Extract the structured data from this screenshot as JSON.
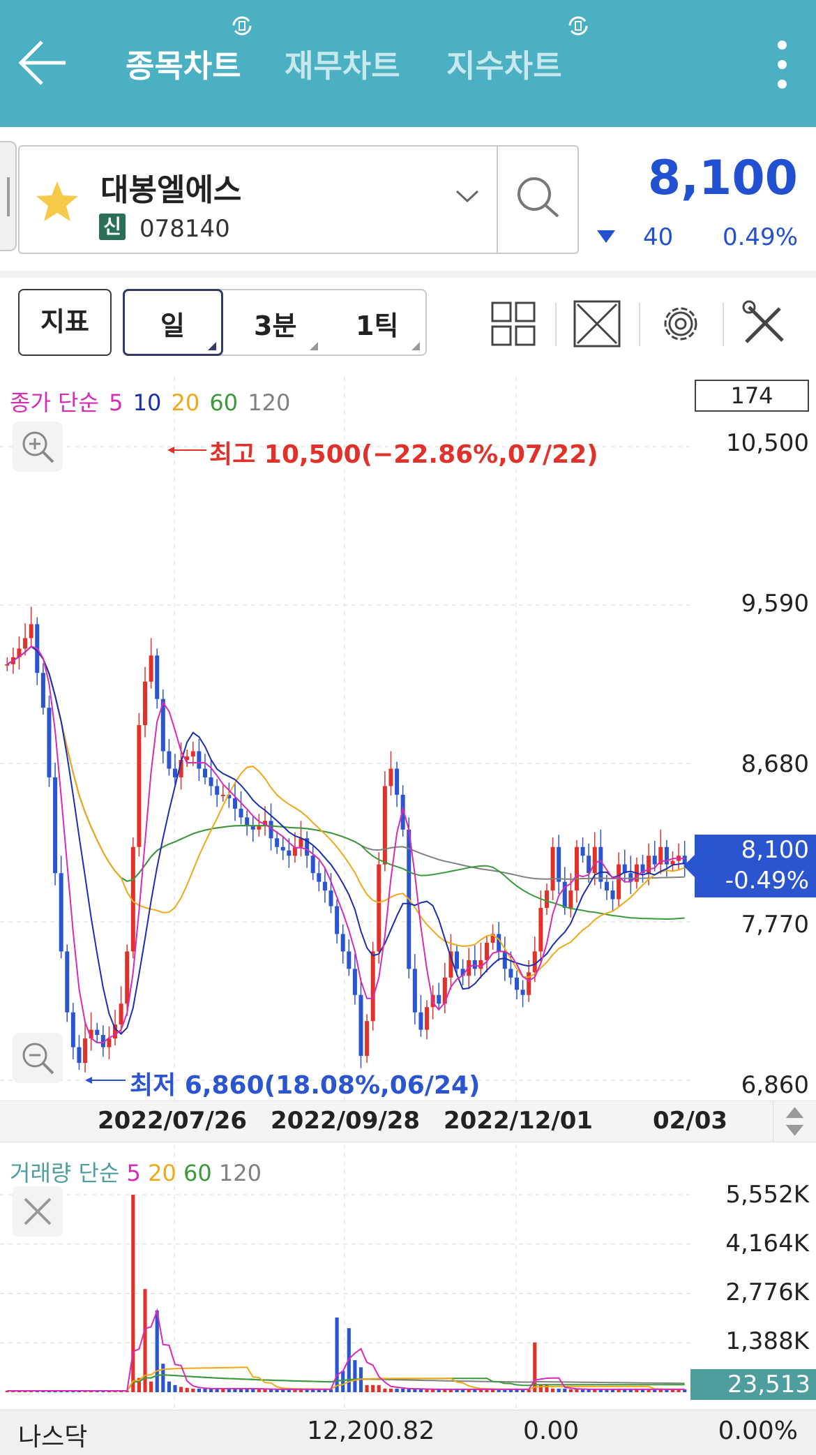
{
  "header": {
    "tabs": [
      {
        "label": "종목차트",
        "active": true
      },
      {
        "label": "재무차트",
        "active": false
      },
      {
        "label": "지수차트",
        "active": false
      }
    ],
    "colors": {
      "bar": "#4bb0c1"
    }
  },
  "stock": {
    "name": "대봉엘에스",
    "badge": "신",
    "code": "078140",
    "price": "8,100",
    "change": "40",
    "change_pct": "0.49%",
    "direction": "down",
    "color": "#2150d0"
  },
  "toolbar": {
    "indicator_label": "지표",
    "periods": [
      "일",
      "3분",
      "1틱"
    ],
    "selected_period": "일",
    "tools": [
      "layout-grid-icon",
      "fullscreen-icon",
      "settings-gear-icon",
      "tools-icon"
    ]
  },
  "price_chart": {
    "legend": {
      "prefix": "종가 단순",
      "periods": [
        {
          "label": "5",
          "color": "#d62bb8"
        },
        {
          "label": "10",
          "color": "#1a2fb0"
        },
        {
          "label": "20",
          "color": "#f0a818"
        },
        {
          "label": "60",
          "color": "#3a9a3a"
        },
        {
          "label": "120",
          "color": "#808080"
        }
      ]
    },
    "visible_count": "174",
    "y_ticks": [
      "10,500",
      "9,590",
      "8,680",
      "7,770",
      "6,860"
    ],
    "current": {
      "price": "8,100",
      "pct": "-0.49%"
    },
    "high_label": "최고 10,500(−22.86%,07/22)",
    "low_label": "최저 6,860(18.08%,06/24)",
    "x_ticks": [
      "2022/07/26",
      "2022/09/28",
      "2022/12/01",
      "02/03"
    ]
  },
  "volume_chart": {
    "legend": {
      "prefix": "거래량 단순",
      "periods": [
        {
          "label": "5",
          "color": "#d62bb8"
        },
        {
          "label": "20",
          "color": "#f0a818"
        },
        {
          "label": "60",
          "color": "#3a9a3a"
        },
        {
          "label": "120",
          "color": "#808080"
        }
      ]
    },
    "y_ticks": [
      "5,552K",
      "4,164K",
      "2,776K",
      "1,388K"
    ],
    "current": "23,513"
  },
  "bottom": {
    "index_name": "나스닥",
    "value": "12,200.82",
    "change": "0.00",
    "pct": "0.00%"
  },
  "chart_data": {
    "type": "candlestick",
    "ylim": [
      6860,
      10500
    ],
    "series_close": [
      9250,
      9290,
      9340,
      9400,
      9480,
      9200,
      9000,
      8600,
      8050,
      7600,
      7250,
      7050,
      6960,
      7100,
      7150,
      7120,
      7050,
      7100,
      7180,
      7300,
      7600,
      8200,
      8900,
      9150,
      9300,
      9050,
      8750,
      8650,
      8600,
      8700,
      8720,
      8750,
      8650,
      8600,
      8550,
      8500,
      8500,
      8480,
      8420,
      8370,
      8320,
      8300,
      8320,
      8350,
      8250,
      8200,
      8180,
      8150,
      8200,
      8250,
      8150,
      8050,
      8000,
      7950,
      7860,
      7700,
      7600,
      7500,
      7350,
      7000,
      7200,
      7600,
      8100,
      8550,
      8650,
      8500,
      8300,
      7500,
      7250,
      7150,
      7280,
      7350,
      7300,
      7450,
      7600,
      7500,
      7460,
      7550,
      7500,
      7550,
      7650,
      7700,
      7600,
      7500,
      7450,
      7380,
      7350,
      7480,
      7600,
      7850,
      7950,
      8200,
      8000,
      7850,
      7950,
      8200,
      8150,
      8050,
      8200,
      8000,
      7950,
      7900,
      8100,
      8050,
      8000,
      8100,
      8050,
      8150,
      8100,
      8200,
      8100,
      8120,
      8150,
      8100
    ],
    "volume_k": [
      40,
      40,
      40,
      40,
      40,
      40,
      40,
      40,
      40,
      40,
      40,
      40,
      40,
      40,
      40,
      40,
      40,
      40,
      40,
      40,
      40,
      5552,
      400,
      2900,
      300,
      2300,
      800,
      300,
      200,
      150,
      120,
      100,
      100,
      100,
      100,
      100,
      100,
      100,
      100,
      100,
      100,
      100,
      80,
      80,
      80,
      80,
      80,
      80,
      80,
      80,
      80,
      80,
      80,
      80,
      80,
      2100,
      600,
      1800,
      900,
      700,
      200,
      200,
      200,
      100,
      100,
      100,
      100,
      100,
      80,
      80,
      80,
      80,
      80,
      80,
      80,
      80,
      80,
      80,
      80,
      80,
      80,
      80,
      80,
      80,
      80,
      80,
      80,
      80,
      1400,
      200,
      200,
      100,
      100,
      100,
      80,
      80,
      80,
      80,
      80,
      80,
      80,
      80,
      80,
      80,
      80,
      80,
      80,
      80,
      80,
      80,
      80,
      80,
      80,
      80
    ],
    "ma_colors": {
      "5": "#d62bb8",
      "10": "#1a2fb0",
      "20": "#f0a818",
      "60": "#3a9a3a",
      "120": "#808080"
    }
  }
}
